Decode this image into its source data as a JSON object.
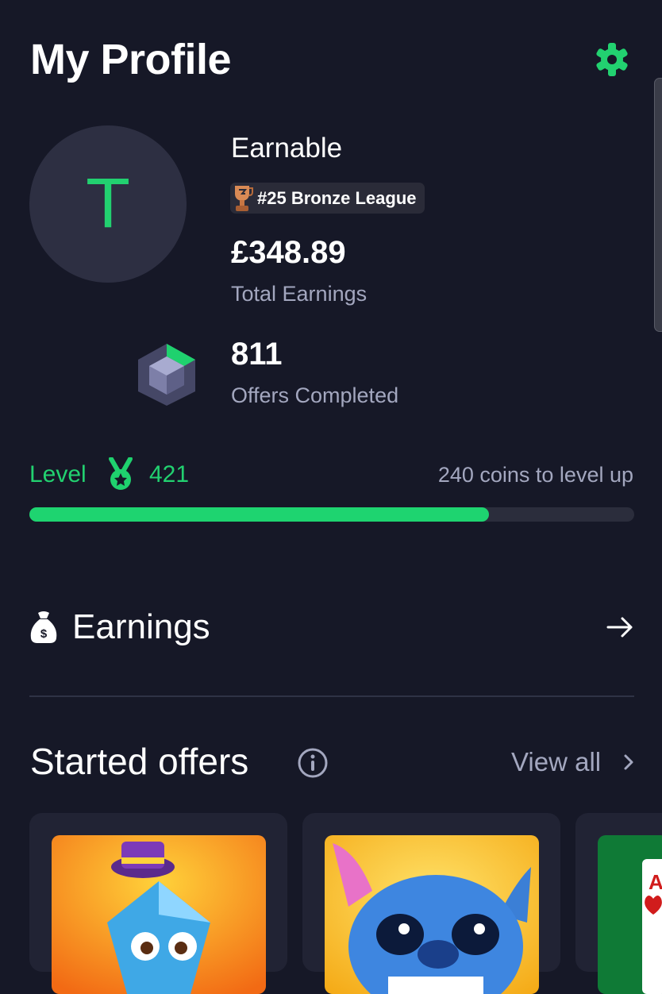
{
  "header": {
    "title": "My Profile",
    "settings_icon": "gear-icon",
    "accent_color": "#22d170"
  },
  "profile": {
    "avatar_initial": "T",
    "username": "Earnable",
    "league": "#25 Bronze League",
    "total_earnings_value": "£348.89",
    "total_earnings_label": "Total Earnings",
    "offers_completed_value": "811",
    "offers_completed_label": "Offers Completed"
  },
  "level": {
    "label": "Level",
    "number": "421",
    "coins_to_next": "240 coins to level up",
    "progress_fraction": 0.76
  },
  "earnings_section": {
    "label": "Earnings"
  },
  "started_offers": {
    "title": "Started offers",
    "view_all": "View all",
    "cards": [
      {
        "name": "Diamond character game",
        "color": "#f08a1f"
      },
      {
        "name": "Stitch game",
        "color": "#f2c21a"
      },
      {
        "name": "Solitaire game",
        "color": "#0f7a36"
      }
    ]
  }
}
